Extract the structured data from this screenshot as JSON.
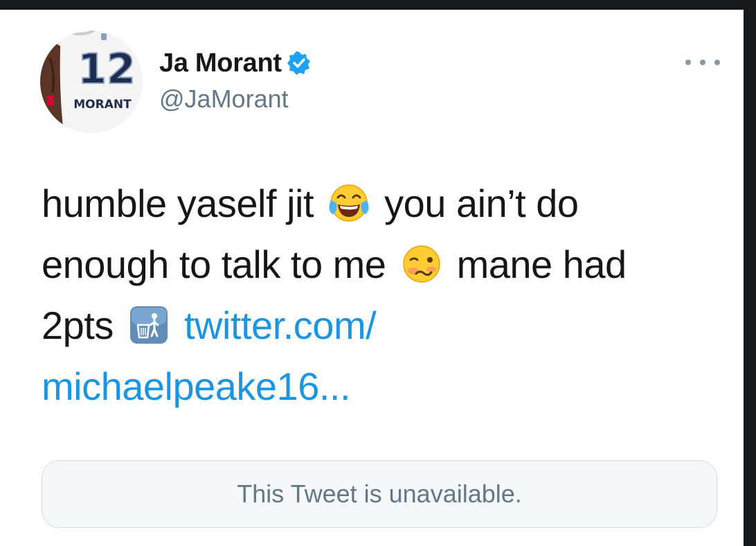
{
  "tweet": {
    "author": {
      "display_name": "Ja Morant",
      "handle": "@JaMorant",
      "verified": true,
      "avatar": {
        "jersey_number": "12",
        "jersey_name": "MORANT"
      }
    },
    "text": {
      "line1_a": "humble yaself jit",
      "line1_b": "you ain’t do",
      "line2_a": "enough to talk to me",
      "line2_b": "mane had",
      "line3_a": "2pts",
      "link_part1": "twitter.com/",
      "link_part2": "michaelpeake16..."
    },
    "emojis": [
      "face-with-tears-of-joy-icon",
      "woozy-face-icon",
      "wastebasket-icon"
    ],
    "quoted_tweet": {
      "message": "This Tweet is unavailable."
    }
  },
  "colors": {
    "link": "#1b95e0",
    "verified_badge": "#1da1f2",
    "text_primary": "#14171a",
    "text_secondary": "#657786"
  }
}
